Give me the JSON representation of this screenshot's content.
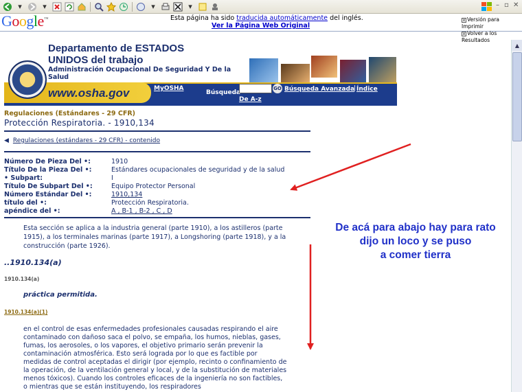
{
  "browser": {
    "toolbar_icons": [
      "back-icon",
      "forward-icon",
      "stop-icon",
      "refresh-icon",
      "home-icon",
      "search-icon",
      "favorites-icon",
      "history-icon",
      "mail-icon",
      "print-icon",
      "edit-icon",
      "discuss-icon"
    ]
  },
  "google": {
    "logo": "Google",
    "message_prefix": "Esta página ha sido",
    "message_link": "traducida automáticamente",
    "message_suffix": "del inglés.",
    "original_link": "Ver la Página Web Original",
    "opt_print": "Versión para Imprimir",
    "opt_results": "Volver a los Resultados"
  },
  "header": {
    "title_line1": "Departamento de ESTADOS",
    "title_line2": "UNIDOS del trabajo",
    "subtitle": "Administración Ocupacional De Seguridad Y De la Salud",
    "site": "www.osha.gov",
    "myosha": "MyOSHA",
    "search_label": "Búsqueda",
    "go": "GO",
    "advanced": "Búsqueda Avanzada",
    "index": "Índice",
    "az": "De A-z"
  },
  "page": {
    "section": "Regulaciones (Estándares - 29 CFR)",
    "title": "Protección Respiratoria. - 1910,134",
    "crumb": "Regulaciones (estándares - 29 CFR) - contenido"
  },
  "meta": [
    {
      "k": "Número De Pieza Del •:",
      "v": "1910"
    },
    {
      "k": "Título De la Pieza Del •:",
      "v": "Estándares ocupacionales de seguridad y de la salud"
    },
    {
      "k": "• Subpart:",
      "v": "I"
    },
    {
      "k": "Título De Subpart Del •:",
      "v": "Equipo Protector Personal"
    },
    {
      "k": "Número Estándar Del •:",
      "v": "1910,134"
    },
    {
      "k": "título del •:",
      "v": "Protección Respiratoria."
    },
    {
      "k": "apéndice del •:",
      "v": "A , B-1 , B-2 , C , D"
    }
  ],
  "body": {
    "p1": "Esta sección se aplica a la industria general (parte 1910), a los astilleros (parte 1915), a los terminales marinas (parte 1917), a Longshoring (parte 1918), y a la construcción (parte 1926).",
    "heading": "..1910.134(a)",
    "ref1": "1910.134(a)",
    "practice": "práctica permitida.",
    "ref2": "1910.134(a)(1)",
    "p2": "en el control de esas enfermedades profesionales causadas respirando el aire contaminado con dañoso saca el polvo, se empaña, los humos, nieblas, gases, fumas, los aerosoles, o los vapores, el objetivo primario serán prevenir la contaminación atmosférica. Esto será lograda por lo que es factible por medidas de control aceptadas el dirigir (por ejemplo, recinto o confinamiento de la operación, de la ventilación general y local, y de la substitución de materiales menos tóxicos). Cuando los controles eficaces de la ingeniería no son factibles, o mientras que se están instituyendo, los respiradores"
  },
  "annotation": {
    "line1": "De acá para abajo hay  para rato",
    "line2": "dijo un loco y se puso",
    "line3": "a comer tierra",
    "color": "#2030c8"
  },
  "colors": {
    "navy": "#1b2f6e",
    "gold": "#e3b51a",
    "red_arrow": "#e02020"
  }
}
